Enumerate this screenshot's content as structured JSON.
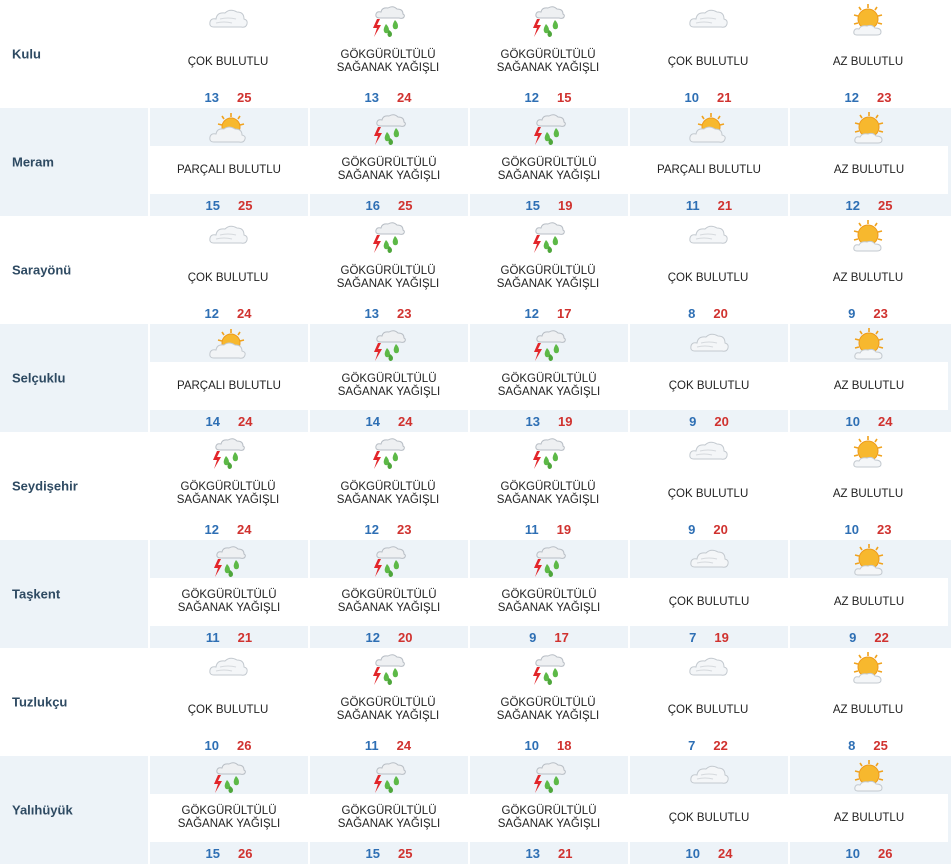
{
  "colors": {
    "row_bg": "#edf3f8",
    "low": "#2e6fb4",
    "high": "#d0322f",
    "district": "#2e4a62"
  },
  "rows": [
    {
      "district": "Kulu",
      "days": [
        {
          "icon": "cloudy-icon",
          "desc": "ÇOK BULUTLU",
          "low": "13",
          "high": "25"
        },
        {
          "icon": "thunder-rain-icon",
          "desc": "GÖKGÜRÜLTÜLÜ SAĞANAK YAĞIŞLI",
          "low": "13",
          "high": "24"
        },
        {
          "icon": "thunder-rain-icon",
          "desc": "GÖKGÜRÜLTÜLÜ SAĞANAK YAĞIŞLI",
          "low": "12",
          "high": "15"
        },
        {
          "icon": "cloudy-icon",
          "desc": "ÇOK BULUTLU",
          "low": "10",
          "high": "21"
        },
        {
          "icon": "mostly-sunny-icon",
          "desc": "AZ BULUTLU",
          "low": "12",
          "high": "23"
        }
      ]
    },
    {
      "district": "Meram",
      "days": [
        {
          "icon": "partly-cloudy-icon",
          "desc": "PARÇALI BULUTLU",
          "low": "15",
          "high": "25"
        },
        {
          "icon": "thunder-rain-icon",
          "desc": "GÖKGÜRÜLTÜLÜ SAĞANAK YAĞIŞLI",
          "low": "16",
          "high": "25"
        },
        {
          "icon": "thunder-rain-icon",
          "desc": "GÖKGÜRÜLTÜLÜ SAĞANAK YAĞIŞLI",
          "low": "15",
          "high": "19"
        },
        {
          "icon": "partly-cloudy-icon",
          "desc": "PARÇALI BULUTLU",
          "low": "11",
          "high": "21"
        },
        {
          "icon": "mostly-sunny-icon",
          "desc": "AZ BULUTLU",
          "low": "12",
          "high": "25"
        }
      ]
    },
    {
      "district": "Sarayönü",
      "days": [
        {
          "icon": "cloudy-icon",
          "desc": "ÇOK BULUTLU",
          "low": "12",
          "high": "24"
        },
        {
          "icon": "thunder-rain-icon",
          "desc": "GÖKGÜRÜLTÜLÜ SAĞANAK YAĞIŞLI",
          "low": "13",
          "high": "23"
        },
        {
          "icon": "thunder-rain-icon",
          "desc": "GÖKGÜRÜLTÜLÜ SAĞANAK YAĞIŞLI",
          "low": "12",
          "high": "17"
        },
        {
          "icon": "cloudy-icon",
          "desc": "ÇOK BULUTLU",
          "low": "8",
          "high": "20"
        },
        {
          "icon": "mostly-sunny-icon",
          "desc": "AZ BULUTLU",
          "low": "9",
          "high": "23"
        }
      ]
    },
    {
      "district": "Selçuklu",
      "days": [
        {
          "icon": "partly-cloudy-icon",
          "desc": "PARÇALI BULUTLU",
          "low": "14",
          "high": "24"
        },
        {
          "icon": "thunder-rain-icon",
          "desc": "GÖKGÜRÜLTÜLÜ SAĞANAK YAĞIŞLI",
          "low": "14",
          "high": "24"
        },
        {
          "icon": "thunder-rain-icon",
          "desc": "GÖKGÜRÜLTÜLÜ SAĞANAK YAĞIŞLI",
          "low": "13",
          "high": "19"
        },
        {
          "icon": "cloudy-icon",
          "desc": "ÇOK BULUTLU",
          "low": "9",
          "high": "20"
        },
        {
          "icon": "mostly-sunny-icon",
          "desc": "AZ BULUTLU",
          "low": "10",
          "high": "24"
        }
      ]
    },
    {
      "district": "Seydişehir",
      "days": [
        {
          "icon": "thunder-rain-icon",
          "desc": "GÖKGÜRÜLTÜLÜ SAĞANAK YAĞIŞLI",
          "low": "12",
          "high": "24"
        },
        {
          "icon": "thunder-rain-icon",
          "desc": "GÖKGÜRÜLTÜLÜ SAĞANAK YAĞIŞLI",
          "low": "12",
          "high": "23"
        },
        {
          "icon": "thunder-rain-icon",
          "desc": "GÖKGÜRÜLTÜLÜ SAĞANAK YAĞIŞLI",
          "low": "11",
          "high": "19"
        },
        {
          "icon": "cloudy-icon",
          "desc": "ÇOK BULUTLU",
          "low": "9",
          "high": "20"
        },
        {
          "icon": "mostly-sunny-icon",
          "desc": "AZ BULUTLU",
          "low": "10",
          "high": "23"
        }
      ]
    },
    {
      "district": "Taşkent",
      "days": [
        {
          "icon": "thunder-rain-icon",
          "desc": "GÖKGÜRÜLTÜLÜ SAĞANAK YAĞIŞLI",
          "low": "11",
          "high": "21"
        },
        {
          "icon": "thunder-rain-icon",
          "desc": "GÖKGÜRÜLTÜLÜ SAĞANAK YAĞIŞLI",
          "low": "12",
          "high": "20"
        },
        {
          "icon": "thunder-rain-icon",
          "desc": "GÖKGÜRÜLTÜLÜ SAĞANAK YAĞIŞLI",
          "low": "9",
          "high": "17"
        },
        {
          "icon": "cloudy-icon",
          "desc": "ÇOK BULUTLU",
          "low": "7",
          "high": "19"
        },
        {
          "icon": "mostly-sunny-icon",
          "desc": "AZ BULUTLU",
          "low": "9",
          "high": "22"
        }
      ]
    },
    {
      "district": "Tuzlukçu",
      "days": [
        {
          "icon": "cloudy-icon",
          "desc": "ÇOK BULUTLU",
          "low": "10",
          "high": "26"
        },
        {
          "icon": "thunder-rain-icon",
          "desc": "GÖKGÜRÜLTÜLÜ SAĞANAK YAĞIŞLI",
          "low": "11",
          "high": "24"
        },
        {
          "icon": "thunder-rain-icon",
          "desc": "GÖKGÜRÜLTÜLÜ SAĞANAK YAĞIŞLI",
          "low": "10",
          "high": "18"
        },
        {
          "icon": "cloudy-icon",
          "desc": "ÇOK BULUTLU",
          "low": "7",
          "high": "22"
        },
        {
          "icon": "mostly-sunny-icon",
          "desc": "AZ BULUTLU",
          "low": "8",
          "high": "25"
        }
      ]
    },
    {
      "district": "Yalıhüyük",
      "days": [
        {
          "icon": "thunder-rain-icon",
          "desc": "GÖKGÜRÜLTÜLÜ SAĞANAK YAĞIŞLI",
          "low": "15",
          "high": "26"
        },
        {
          "icon": "thunder-rain-icon",
          "desc": "GÖKGÜRÜLTÜLÜ SAĞANAK YAĞIŞLI",
          "low": "15",
          "high": "25"
        },
        {
          "icon": "thunder-rain-icon",
          "desc": "GÖKGÜRÜLTÜLÜ SAĞANAK YAĞIŞLI",
          "low": "13",
          "high": "21"
        },
        {
          "icon": "cloudy-icon",
          "desc": "ÇOK BULUTLU",
          "low": "10",
          "high": "24"
        },
        {
          "icon": "mostly-sunny-icon",
          "desc": "AZ BULUTLU",
          "low": "10",
          "high": "26"
        }
      ]
    }
  ]
}
